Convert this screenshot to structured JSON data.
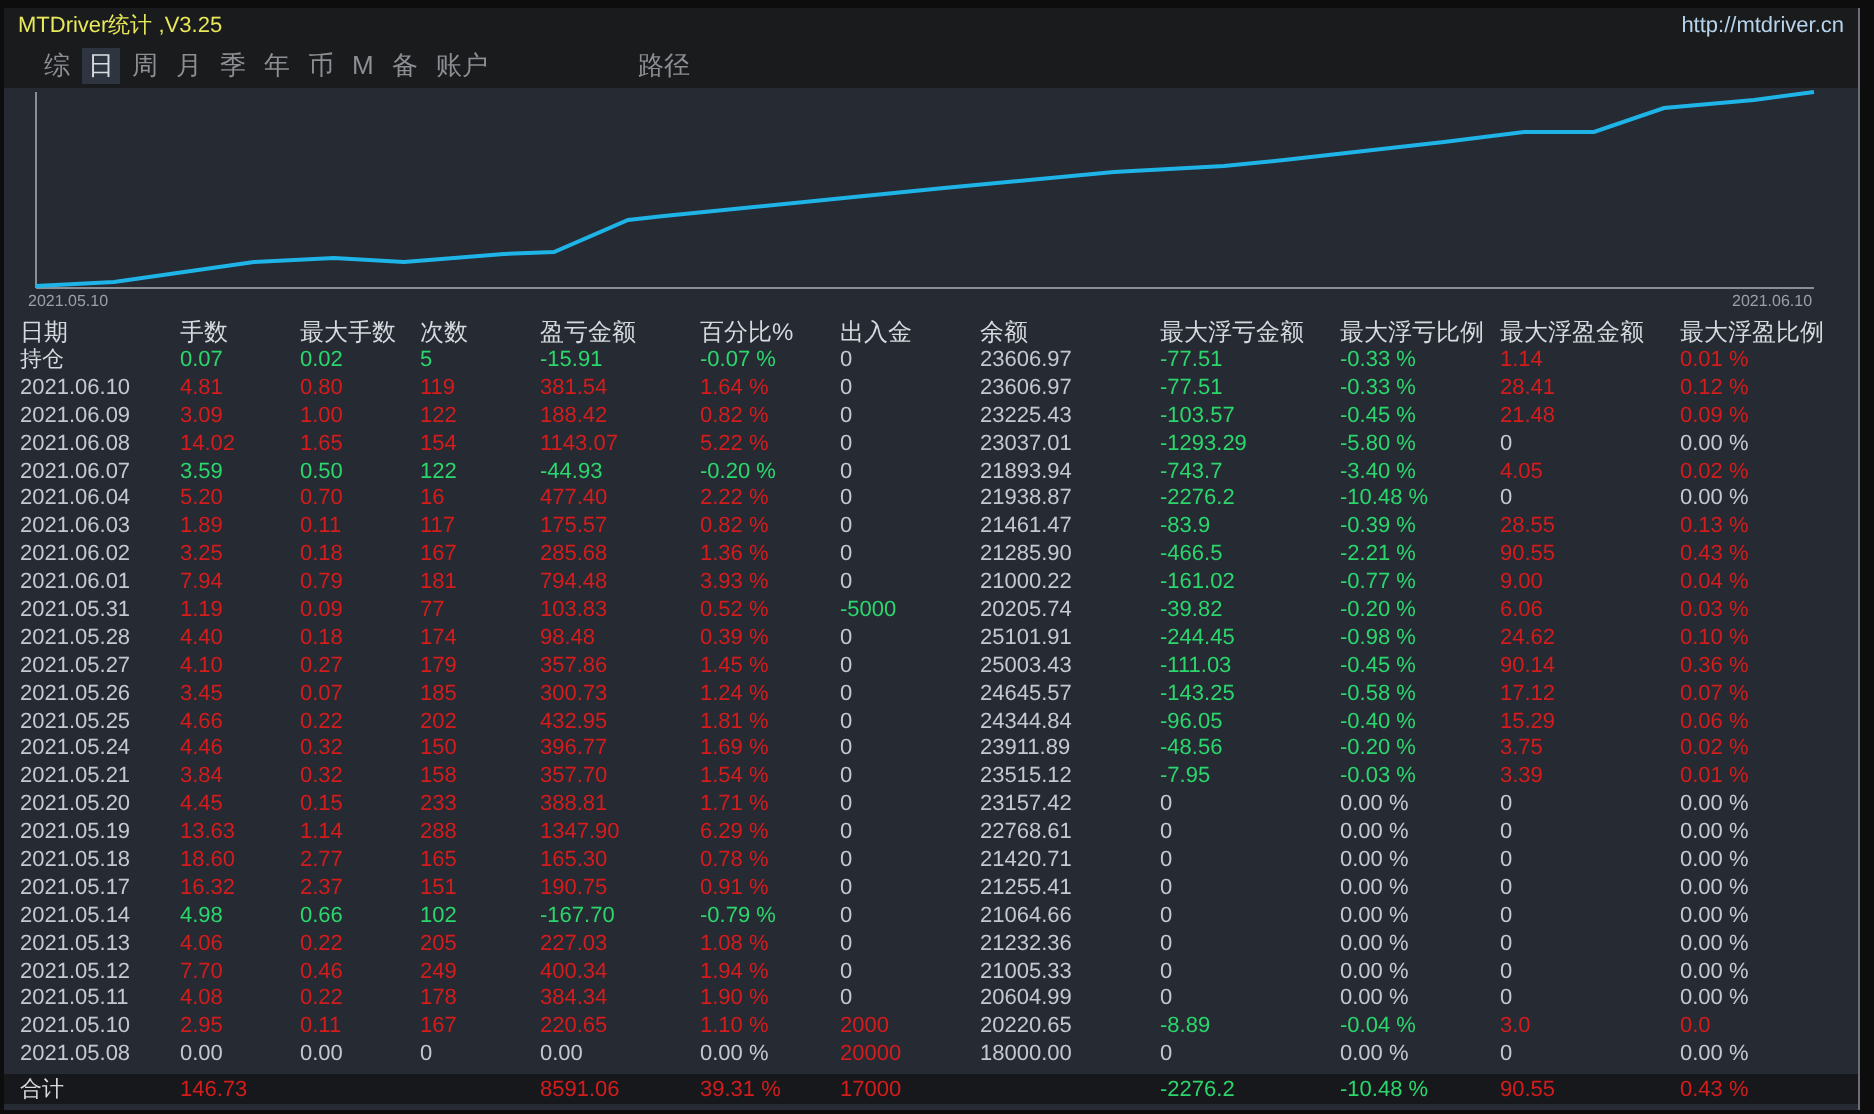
{
  "window": {
    "title": "MTDriver统计 ,V3.25",
    "link": "http://mtdriver.cn"
  },
  "tabs": [
    {
      "label": "综",
      "selected": false
    },
    {
      "label": "日",
      "selected": true
    },
    {
      "label": "周",
      "selected": false
    },
    {
      "label": "月",
      "selected": false
    },
    {
      "label": "季",
      "selected": false
    },
    {
      "label": "年",
      "selected": false
    },
    {
      "label": "币",
      "selected": false
    },
    {
      "label": "M",
      "selected": false
    },
    {
      "label": "备",
      "selected": false
    },
    {
      "label": "账户",
      "selected": false
    }
  ],
  "path_button": "路径",
  "chart": {
    "start_label": "2021.05.10",
    "end_label": "2021.06.10"
  },
  "table": {
    "columns": [
      "日期",
      "手数",
      "最大手数",
      "次数",
      "盈亏金额",
      "百分比%",
      "出入金",
      "余额",
      "最大浮亏金额",
      "最大浮亏比例",
      "最大浮盈金额",
      "最大浮盈比例"
    ],
    "rows": [
      {
        "cells": [
          {
            "text": "持仓",
            "color": "#d6d9dd"
          },
          {
            "text": "0.07",
            "color": "#2bd66c"
          },
          {
            "text": "0.02",
            "color": "#2bd66c"
          },
          {
            "text": "5",
            "color": "#2bd66c"
          },
          {
            "text": "-15.91",
            "color": "#2bd66c"
          },
          {
            "text": "-0.07 %",
            "color": "#2bd66c"
          },
          {
            "text": "0",
            "color": "#c4c9cf"
          },
          {
            "text": "23606.97",
            "color": "#c4c9cf"
          },
          {
            "text": "-77.51",
            "color": "#2bd66c"
          },
          {
            "text": "-0.33 %",
            "color": "#2bd66c"
          },
          {
            "text": "1.14",
            "color": "#d41c1c"
          },
          {
            "text": "0.01 %",
            "color": "#d41c1c"
          }
        ]
      },
      {
        "cells": [
          {
            "text": "2021.06.10",
            "color": "#c4c9cf"
          },
          {
            "text": "4.81",
            "color": "#d41c1c"
          },
          {
            "text": "0.80",
            "color": "#d41c1c"
          },
          {
            "text": "119",
            "color": "#d41c1c"
          },
          {
            "text": "381.54",
            "color": "#d41c1c"
          },
          {
            "text": "1.64 %",
            "color": "#d41c1c"
          },
          {
            "text": "0",
            "color": "#c4c9cf"
          },
          {
            "text": "23606.97",
            "color": "#c4c9cf"
          },
          {
            "text": "-77.51",
            "color": "#2bd66c"
          },
          {
            "text": "-0.33 %",
            "color": "#2bd66c"
          },
          {
            "text": "28.41",
            "color": "#d41c1c"
          },
          {
            "text": "0.12 %",
            "color": "#d41c1c"
          }
        ]
      },
      {
        "cells": [
          {
            "text": "2021.06.09",
            "color": "#c4c9cf"
          },
          {
            "text": "3.09",
            "color": "#d41c1c"
          },
          {
            "text": "1.00",
            "color": "#d41c1c"
          },
          {
            "text": "122",
            "color": "#d41c1c"
          },
          {
            "text": "188.42",
            "color": "#d41c1c"
          },
          {
            "text": "0.82 %",
            "color": "#d41c1c"
          },
          {
            "text": "0",
            "color": "#c4c9cf"
          },
          {
            "text": "23225.43",
            "color": "#c4c9cf"
          },
          {
            "text": "-103.57",
            "color": "#2bd66c"
          },
          {
            "text": "-0.45 %",
            "color": "#2bd66c"
          },
          {
            "text": "21.48",
            "color": "#d41c1c"
          },
          {
            "text": "0.09 %",
            "color": "#d41c1c"
          }
        ]
      },
      {
        "cells": [
          {
            "text": "2021.06.08",
            "color": "#c4c9cf"
          },
          {
            "text": "14.02",
            "color": "#d41c1c"
          },
          {
            "text": "1.65",
            "color": "#d41c1c"
          },
          {
            "text": "154",
            "color": "#d41c1c"
          },
          {
            "text": "1143.07",
            "color": "#d41c1c"
          },
          {
            "text": "5.22 %",
            "color": "#d41c1c"
          },
          {
            "text": "0",
            "color": "#c4c9cf"
          },
          {
            "text": "23037.01",
            "color": "#c4c9cf"
          },
          {
            "text": "-1293.29",
            "color": "#2bd66c"
          },
          {
            "text": "-5.80 %",
            "color": "#2bd66c"
          },
          {
            "text": "0",
            "color": "#c4c9cf"
          },
          {
            "text": "0.00 %",
            "color": "#c4c9cf"
          }
        ]
      },
      {
        "cells": [
          {
            "text": "2021.06.07",
            "color": "#c4c9cf"
          },
          {
            "text": "3.59",
            "color": "#2bd66c"
          },
          {
            "text": "0.50",
            "color": "#2bd66c"
          },
          {
            "text": "122",
            "color": "#2bd66c"
          },
          {
            "text": "-44.93",
            "color": "#2bd66c"
          },
          {
            "text": "-0.20 %",
            "color": "#2bd66c"
          },
          {
            "text": "0",
            "color": "#c4c9cf"
          },
          {
            "text": "21893.94",
            "color": "#c4c9cf"
          },
          {
            "text": "-743.7",
            "color": "#2bd66c"
          },
          {
            "text": "-3.40 %",
            "color": "#2bd66c"
          },
          {
            "text": "4.05",
            "color": "#d41c1c"
          },
          {
            "text": "0.02 %",
            "color": "#d41c1c"
          }
        ]
      },
      {
        "cells": [
          {
            "text": "2021.06.04",
            "color": "#c4c9cf"
          },
          {
            "text": "5.20",
            "color": "#d41c1c"
          },
          {
            "text": "0.70",
            "color": "#d41c1c"
          },
          {
            "text": "16",
            "color": "#d41c1c"
          },
          {
            "text": "477.40",
            "color": "#d41c1c"
          },
          {
            "text": "2.22 %",
            "color": "#d41c1c"
          },
          {
            "text": "0",
            "color": "#c4c9cf"
          },
          {
            "text": "21938.87",
            "color": "#c4c9cf"
          },
          {
            "text": "-2276.2",
            "color": "#2bd66c"
          },
          {
            "text": "-10.48 %",
            "color": "#2bd66c"
          },
          {
            "text": "0",
            "color": "#c4c9cf"
          },
          {
            "text": "0.00 %",
            "color": "#c4c9cf"
          }
        ]
      },
      {
        "cells": [
          {
            "text": "2021.06.03",
            "color": "#c4c9cf"
          },
          {
            "text": "1.89",
            "color": "#d41c1c"
          },
          {
            "text": "0.11",
            "color": "#d41c1c"
          },
          {
            "text": "117",
            "color": "#d41c1c"
          },
          {
            "text": "175.57",
            "color": "#d41c1c"
          },
          {
            "text": "0.82 %",
            "color": "#d41c1c"
          },
          {
            "text": "0",
            "color": "#c4c9cf"
          },
          {
            "text": "21461.47",
            "color": "#c4c9cf"
          },
          {
            "text": "-83.9",
            "color": "#2bd66c"
          },
          {
            "text": "-0.39 %",
            "color": "#2bd66c"
          },
          {
            "text": "28.55",
            "color": "#d41c1c"
          },
          {
            "text": "0.13 %",
            "color": "#d41c1c"
          }
        ]
      },
      {
        "cells": [
          {
            "text": "2021.06.02",
            "color": "#c4c9cf"
          },
          {
            "text": "3.25",
            "color": "#d41c1c"
          },
          {
            "text": "0.18",
            "color": "#d41c1c"
          },
          {
            "text": "167",
            "color": "#d41c1c"
          },
          {
            "text": "285.68",
            "color": "#d41c1c"
          },
          {
            "text": "1.36 %",
            "color": "#d41c1c"
          },
          {
            "text": "0",
            "color": "#c4c9cf"
          },
          {
            "text": "21285.90",
            "color": "#c4c9cf"
          },
          {
            "text": "-466.5",
            "color": "#2bd66c"
          },
          {
            "text": "-2.21 %",
            "color": "#2bd66c"
          },
          {
            "text": "90.55",
            "color": "#d41c1c"
          },
          {
            "text": "0.43 %",
            "color": "#d41c1c"
          }
        ]
      },
      {
        "cells": [
          {
            "text": "2021.06.01",
            "color": "#c4c9cf"
          },
          {
            "text": "7.94",
            "color": "#d41c1c"
          },
          {
            "text": "0.79",
            "color": "#d41c1c"
          },
          {
            "text": "181",
            "color": "#d41c1c"
          },
          {
            "text": "794.48",
            "color": "#d41c1c"
          },
          {
            "text": "3.93 %",
            "color": "#d41c1c"
          },
          {
            "text": "0",
            "color": "#c4c9cf"
          },
          {
            "text": "21000.22",
            "color": "#c4c9cf"
          },
          {
            "text": "-161.02",
            "color": "#2bd66c"
          },
          {
            "text": "-0.77 %",
            "color": "#2bd66c"
          },
          {
            "text": "9.00",
            "color": "#d41c1c"
          },
          {
            "text": "0.04 %",
            "color": "#d41c1c"
          }
        ]
      },
      {
        "cells": [
          {
            "text": "2021.05.31",
            "color": "#c4c9cf"
          },
          {
            "text": "1.19",
            "color": "#d41c1c"
          },
          {
            "text": "0.09",
            "color": "#d41c1c"
          },
          {
            "text": "77",
            "color": "#d41c1c"
          },
          {
            "text": "103.83",
            "color": "#d41c1c"
          },
          {
            "text": "0.52 %",
            "color": "#d41c1c"
          },
          {
            "text": "-5000",
            "color": "#2bd66c"
          },
          {
            "text": "20205.74",
            "color": "#c4c9cf"
          },
          {
            "text": "-39.82",
            "color": "#2bd66c"
          },
          {
            "text": "-0.20 %",
            "color": "#2bd66c"
          },
          {
            "text": "6.06",
            "color": "#d41c1c"
          },
          {
            "text": "0.03 %",
            "color": "#d41c1c"
          }
        ]
      },
      {
        "cells": [
          {
            "text": "2021.05.28",
            "color": "#c4c9cf"
          },
          {
            "text": "4.40",
            "color": "#d41c1c"
          },
          {
            "text": "0.18",
            "color": "#d41c1c"
          },
          {
            "text": "174",
            "color": "#d41c1c"
          },
          {
            "text": "98.48",
            "color": "#d41c1c"
          },
          {
            "text": "0.39 %",
            "color": "#d41c1c"
          },
          {
            "text": "0",
            "color": "#c4c9cf"
          },
          {
            "text": "25101.91",
            "color": "#c4c9cf"
          },
          {
            "text": "-244.45",
            "color": "#2bd66c"
          },
          {
            "text": "-0.98 %",
            "color": "#2bd66c"
          },
          {
            "text": "24.62",
            "color": "#d41c1c"
          },
          {
            "text": "0.10 %",
            "color": "#d41c1c"
          }
        ]
      },
      {
        "cells": [
          {
            "text": "2021.05.27",
            "color": "#c4c9cf"
          },
          {
            "text": "4.10",
            "color": "#d41c1c"
          },
          {
            "text": "0.27",
            "color": "#d41c1c"
          },
          {
            "text": "179",
            "color": "#d41c1c"
          },
          {
            "text": "357.86",
            "color": "#d41c1c"
          },
          {
            "text": "1.45 %",
            "color": "#d41c1c"
          },
          {
            "text": "0",
            "color": "#c4c9cf"
          },
          {
            "text": "25003.43",
            "color": "#c4c9cf"
          },
          {
            "text": "-111.03",
            "color": "#2bd66c"
          },
          {
            "text": "-0.45 %",
            "color": "#2bd66c"
          },
          {
            "text": "90.14",
            "color": "#d41c1c"
          },
          {
            "text": "0.36 %",
            "color": "#d41c1c"
          }
        ]
      },
      {
        "cells": [
          {
            "text": "2021.05.26",
            "color": "#c4c9cf"
          },
          {
            "text": "3.45",
            "color": "#d41c1c"
          },
          {
            "text": "0.07",
            "color": "#d41c1c"
          },
          {
            "text": "185",
            "color": "#d41c1c"
          },
          {
            "text": "300.73",
            "color": "#d41c1c"
          },
          {
            "text": "1.24 %",
            "color": "#d41c1c"
          },
          {
            "text": "0",
            "color": "#c4c9cf"
          },
          {
            "text": "24645.57",
            "color": "#c4c9cf"
          },
          {
            "text": "-143.25",
            "color": "#2bd66c"
          },
          {
            "text": "-0.58 %",
            "color": "#2bd66c"
          },
          {
            "text": "17.12",
            "color": "#d41c1c"
          },
          {
            "text": "0.07 %",
            "color": "#d41c1c"
          }
        ]
      },
      {
        "cells": [
          {
            "text": "2021.05.25",
            "color": "#c4c9cf"
          },
          {
            "text": "4.66",
            "color": "#d41c1c"
          },
          {
            "text": "0.22",
            "color": "#d41c1c"
          },
          {
            "text": "202",
            "color": "#d41c1c"
          },
          {
            "text": "432.95",
            "color": "#d41c1c"
          },
          {
            "text": "1.81 %",
            "color": "#d41c1c"
          },
          {
            "text": "0",
            "color": "#c4c9cf"
          },
          {
            "text": "24344.84",
            "color": "#c4c9cf"
          },
          {
            "text": "-96.05",
            "color": "#2bd66c"
          },
          {
            "text": "-0.40 %",
            "color": "#2bd66c"
          },
          {
            "text": "15.29",
            "color": "#d41c1c"
          },
          {
            "text": "0.06 %",
            "color": "#d41c1c"
          }
        ]
      },
      {
        "cells": [
          {
            "text": "2021.05.24",
            "color": "#c4c9cf"
          },
          {
            "text": "4.46",
            "color": "#d41c1c"
          },
          {
            "text": "0.32",
            "color": "#d41c1c"
          },
          {
            "text": "150",
            "color": "#d41c1c"
          },
          {
            "text": "396.77",
            "color": "#d41c1c"
          },
          {
            "text": "1.69 %",
            "color": "#d41c1c"
          },
          {
            "text": "0",
            "color": "#c4c9cf"
          },
          {
            "text": "23911.89",
            "color": "#c4c9cf"
          },
          {
            "text": "-48.56",
            "color": "#2bd66c"
          },
          {
            "text": "-0.20 %",
            "color": "#2bd66c"
          },
          {
            "text": "3.75",
            "color": "#d41c1c"
          },
          {
            "text": "0.02 %",
            "color": "#d41c1c"
          }
        ]
      },
      {
        "cells": [
          {
            "text": "2021.05.21",
            "color": "#c4c9cf"
          },
          {
            "text": "3.84",
            "color": "#d41c1c"
          },
          {
            "text": "0.32",
            "color": "#d41c1c"
          },
          {
            "text": "158",
            "color": "#d41c1c"
          },
          {
            "text": "357.70",
            "color": "#d41c1c"
          },
          {
            "text": "1.54 %",
            "color": "#d41c1c"
          },
          {
            "text": "0",
            "color": "#c4c9cf"
          },
          {
            "text": "23515.12",
            "color": "#c4c9cf"
          },
          {
            "text": "-7.95",
            "color": "#2bd66c"
          },
          {
            "text": "-0.03 %",
            "color": "#2bd66c"
          },
          {
            "text": "3.39",
            "color": "#d41c1c"
          },
          {
            "text": "0.01 %",
            "color": "#d41c1c"
          }
        ]
      },
      {
        "cells": [
          {
            "text": "2021.05.20",
            "color": "#c4c9cf"
          },
          {
            "text": "4.45",
            "color": "#d41c1c"
          },
          {
            "text": "0.15",
            "color": "#d41c1c"
          },
          {
            "text": "233",
            "color": "#d41c1c"
          },
          {
            "text": "388.81",
            "color": "#d41c1c"
          },
          {
            "text": "1.71 %",
            "color": "#d41c1c"
          },
          {
            "text": "0",
            "color": "#c4c9cf"
          },
          {
            "text": "23157.42",
            "color": "#c4c9cf"
          },
          {
            "text": "0",
            "color": "#c4c9cf"
          },
          {
            "text": "0.00 %",
            "color": "#c4c9cf"
          },
          {
            "text": "0",
            "color": "#c4c9cf"
          },
          {
            "text": "0.00 %",
            "color": "#c4c9cf"
          }
        ]
      },
      {
        "cells": [
          {
            "text": "2021.05.19",
            "color": "#c4c9cf"
          },
          {
            "text": "13.63",
            "color": "#d41c1c"
          },
          {
            "text": "1.14",
            "color": "#d41c1c"
          },
          {
            "text": "288",
            "color": "#d41c1c"
          },
          {
            "text": "1347.90",
            "color": "#d41c1c"
          },
          {
            "text": "6.29 %",
            "color": "#d41c1c"
          },
          {
            "text": "0",
            "color": "#c4c9cf"
          },
          {
            "text": "22768.61",
            "color": "#c4c9cf"
          },
          {
            "text": "0",
            "color": "#c4c9cf"
          },
          {
            "text": "0.00 %",
            "color": "#c4c9cf"
          },
          {
            "text": "0",
            "color": "#c4c9cf"
          },
          {
            "text": "0.00 %",
            "color": "#c4c9cf"
          }
        ]
      },
      {
        "cells": [
          {
            "text": "2021.05.18",
            "color": "#c4c9cf"
          },
          {
            "text": "18.60",
            "color": "#d41c1c"
          },
          {
            "text": "2.77",
            "color": "#d41c1c"
          },
          {
            "text": "165",
            "color": "#d41c1c"
          },
          {
            "text": "165.30",
            "color": "#d41c1c"
          },
          {
            "text": "0.78 %",
            "color": "#d41c1c"
          },
          {
            "text": "0",
            "color": "#c4c9cf"
          },
          {
            "text": "21420.71",
            "color": "#c4c9cf"
          },
          {
            "text": "0",
            "color": "#c4c9cf"
          },
          {
            "text": "0.00 %",
            "color": "#c4c9cf"
          },
          {
            "text": "0",
            "color": "#c4c9cf"
          },
          {
            "text": "0.00 %",
            "color": "#c4c9cf"
          }
        ]
      },
      {
        "cells": [
          {
            "text": "2021.05.17",
            "color": "#c4c9cf"
          },
          {
            "text": "16.32",
            "color": "#d41c1c"
          },
          {
            "text": "2.37",
            "color": "#d41c1c"
          },
          {
            "text": "151",
            "color": "#d41c1c"
          },
          {
            "text": "190.75",
            "color": "#d41c1c"
          },
          {
            "text": "0.91 %",
            "color": "#d41c1c"
          },
          {
            "text": "0",
            "color": "#c4c9cf"
          },
          {
            "text": "21255.41",
            "color": "#c4c9cf"
          },
          {
            "text": "0",
            "color": "#c4c9cf"
          },
          {
            "text": "0.00 %",
            "color": "#c4c9cf"
          },
          {
            "text": "0",
            "color": "#c4c9cf"
          },
          {
            "text": "0.00 %",
            "color": "#c4c9cf"
          }
        ]
      },
      {
        "cells": [
          {
            "text": "2021.05.14",
            "color": "#c4c9cf"
          },
          {
            "text": "4.98",
            "color": "#2bd66c"
          },
          {
            "text": "0.66",
            "color": "#2bd66c"
          },
          {
            "text": "102",
            "color": "#2bd66c"
          },
          {
            "text": "-167.70",
            "color": "#2bd66c"
          },
          {
            "text": "-0.79 %",
            "color": "#2bd66c"
          },
          {
            "text": "0",
            "color": "#c4c9cf"
          },
          {
            "text": "21064.66",
            "color": "#c4c9cf"
          },
          {
            "text": "0",
            "color": "#c4c9cf"
          },
          {
            "text": "0.00 %",
            "color": "#c4c9cf"
          },
          {
            "text": "0",
            "color": "#c4c9cf"
          },
          {
            "text": "0.00 %",
            "color": "#c4c9cf"
          }
        ]
      },
      {
        "cells": [
          {
            "text": "2021.05.13",
            "color": "#c4c9cf"
          },
          {
            "text": "4.06",
            "color": "#d41c1c"
          },
          {
            "text": "0.22",
            "color": "#d41c1c"
          },
          {
            "text": "205",
            "color": "#d41c1c"
          },
          {
            "text": "227.03",
            "color": "#d41c1c"
          },
          {
            "text": "1.08 %",
            "color": "#d41c1c"
          },
          {
            "text": "0",
            "color": "#c4c9cf"
          },
          {
            "text": "21232.36",
            "color": "#c4c9cf"
          },
          {
            "text": "0",
            "color": "#c4c9cf"
          },
          {
            "text": "0.00 %",
            "color": "#c4c9cf"
          },
          {
            "text": "0",
            "color": "#c4c9cf"
          },
          {
            "text": "0.00 %",
            "color": "#c4c9cf"
          }
        ]
      },
      {
        "cells": [
          {
            "text": "2021.05.12",
            "color": "#c4c9cf"
          },
          {
            "text": "7.70",
            "color": "#d41c1c"
          },
          {
            "text": "0.46",
            "color": "#d41c1c"
          },
          {
            "text": "249",
            "color": "#d41c1c"
          },
          {
            "text": "400.34",
            "color": "#d41c1c"
          },
          {
            "text": "1.94 %",
            "color": "#d41c1c"
          },
          {
            "text": "0",
            "color": "#c4c9cf"
          },
          {
            "text": "21005.33",
            "color": "#c4c9cf"
          },
          {
            "text": "0",
            "color": "#c4c9cf"
          },
          {
            "text": "0.00 %",
            "color": "#c4c9cf"
          },
          {
            "text": "0",
            "color": "#c4c9cf"
          },
          {
            "text": "0.00 %",
            "color": "#c4c9cf"
          }
        ]
      },
      {
        "cells": [
          {
            "text": "2021.05.11",
            "color": "#c4c9cf"
          },
          {
            "text": "4.08",
            "color": "#d41c1c"
          },
          {
            "text": "0.22",
            "color": "#d41c1c"
          },
          {
            "text": "178",
            "color": "#d41c1c"
          },
          {
            "text": "384.34",
            "color": "#d41c1c"
          },
          {
            "text": "1.90 %",
            "color": "#d41c1c"
          },
          {
            "text": "0",
            "color": "#c4c9cf"
          },
          {
            "text": "20604.99",
            "color": "#c4c9cf"
          },
          {
            "text": "0",
            "color": "#c4c9cf"
          },
          {
            "text": "0.00 %",
            "color": "#c4c9cf"
          },
          {
            "text": "0",
            "color": "#c4c9cf"
          },
          {
            "text": "0.00 %",
            "color": "#c4c9cf"
          }
        ]
      },
      {
        "cells": [
          {
            "text": "2021.05.10",
            "color": "#c4c9cf"
          },
          {
            "text": "2.95",
            "color": "#d41c1c"
          },
          {
            "text": "0.11",
            "color": "#d41c1c"
          },
          {
            "text": "167",
            "color": "#d41c1c"
          },
          {
            "text": "220.65",
            "color": "#d41c1c"
          },
          {
            "text": "1.10 %",
            "color": "#d41c1c"
          },
          {
            "text": "2000",
            "color": "#d41c1c"
          },
          {
            "text": "20220.65",
            "color": "#c4c9cf"
          },
          {
            "text": "-8.89",
            "color": "#2bd66c"
          },
          {
            "text": "-0.04 %",
            "color": "#2bd66c"
          },
          {
            "text": "3.0",
            "color": "#d41c1c"
          },
          {
            "text": "0.0",
            "color": "#d41c1c"
          }
        ]
      },
      {
        "cells": [
          {
            "text": "2021.05.08",
            "color": "#c4c9cf"
          },
          {
            "text": "0.00",
            "color": "#c4c9cf"
          },
          {
            "text": "0.00",
            "color": "#c4c9cf"
          },
          {
            "text": "0",
            "color": "#c4c9cf"
          },
          {
            "text": "0.00",
            "color": "#c4c9cf"
          },
          {
            "text": "0.00 %",
            "color": "#c4c9cf"
          },
          {
            "text": "20000",
            "color": "#d41c1c"
          },
          {
            "text": "18000.00",
            "color": "#c4c9cf"
          },
          {
            "text": "0",
            "color": "#c4c9cf"
          },
          {
            "text": "0.00 %",
            "color": "#c4c9cf"
          },
          {
            "text": "0",
            "color": "#c4c9cf"
          },
          {
            "text": "0.00 %",
            "color": "#c4c9cf"
          }
        ]
      }
    ],
    "total": {
      "cells": [
        {
          "text": "合计",
          "color": "#d6d9dd"
        },
        {
          "text": "146.73",
          "color": "#d41c1c"
        },
        null,
        null,
        {
          "text": "8591.06",
          "color": "#d41c1c"
        },
        {
          "text": "39.31 %",
          "color": "#d41c1c"
        },
        {
          "text": "17000",
          "color": "#d41c1c"
        },
        null,
        {
          "text": "-2276.2",
          "color": "#2bd66c"
        },
        {
          "text": "-10.48 %",
          "color": "#2bd66c"
        },
        {
          "text": "90.55",
          "color": "#d41c1c"
        },
        {
          "text": "0.43 %",
          "color": "#d41c1c"
        }
      ]
    }
  }
}
